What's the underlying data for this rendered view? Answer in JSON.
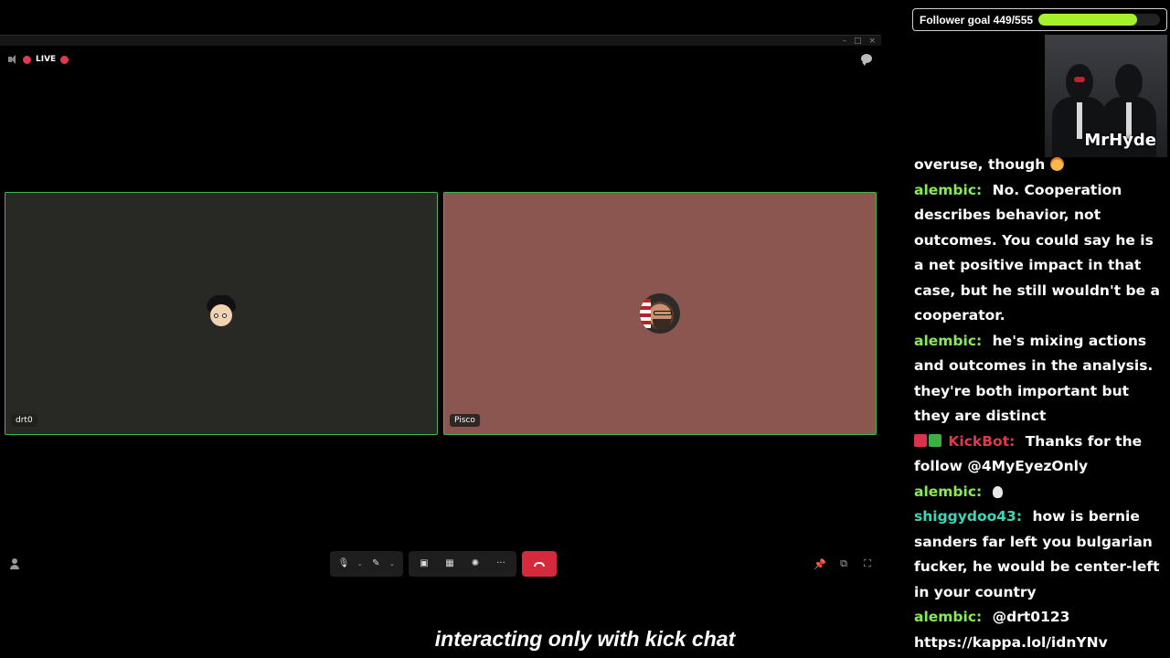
{
  "window": {
    "controls": [
      "–",
      "□",
      "×"
    ]
  },
  "status": {
    "live_label": "LIVE",
    "live_color": "#e0384d"
  },
  "participants": [
    {
      "name": "drt0",
      "tile_color": "#282825",
      "active": true
    },
    {
      "name": "Pisco",
      "tile_color": "#8a564f",
      "active": true
    }
  ],
  "toolbar": {
    "mic_icon": "mic-icon",
    "camera_icon": "camera-off-icon",
    "share_icon": "screen-share-icon",
    "grid_icon": "grid-layout-icon",
    "effects_icon": "effects-icon",
    "more_label": "···",
    "hangup_icon": "hang-up-icon",
    "hangup_color": "#d42a3c",
    "caret": "⌄"
  },
  "right_tools": [
    "pin-icon",
    "popout-icon",
    "fullscreen-icon"
  ],
  "goal": {
    "label": "Follower goal 449/555",
    "current": 449,
    "target": 555,
    "fill_color": "#a6f02c"
  },
  "cam": {
    "name": "MrHyde"
  },
  "chat": {
    "messages": [
      {
        "user": "",
        "text": "overuse, though"
      },
      {
        "user": "alembic:",
        "text": "No. Cooperation describes behavior, not outcomes. You could say he is a net positive impact in that case, but he still wouldn't be a cooperator."
      },
      {
        "user": "alembic:",
        "text": "he's mixing actions and outcomes in the analysis. they're both important but they are distinct"
      },
      {
        "user": "KickBot:",
        "text": "Thanks for the follow @4MyEyezOnly"
      },
      {
        "user": "alembic:",
        "text": ""
      },
      {
        "user": "shiggydoo43:",
        "text": "how is bernie sanders far left you bulgarian fucker, he would be center-left in your country"
      },
      {
        "user": "alembic:",
        "text": "@drt0123 https://kappa.lol/idnYNv"
      }
    ]
  },
  "caption": "interacting only with kick chat"
}
